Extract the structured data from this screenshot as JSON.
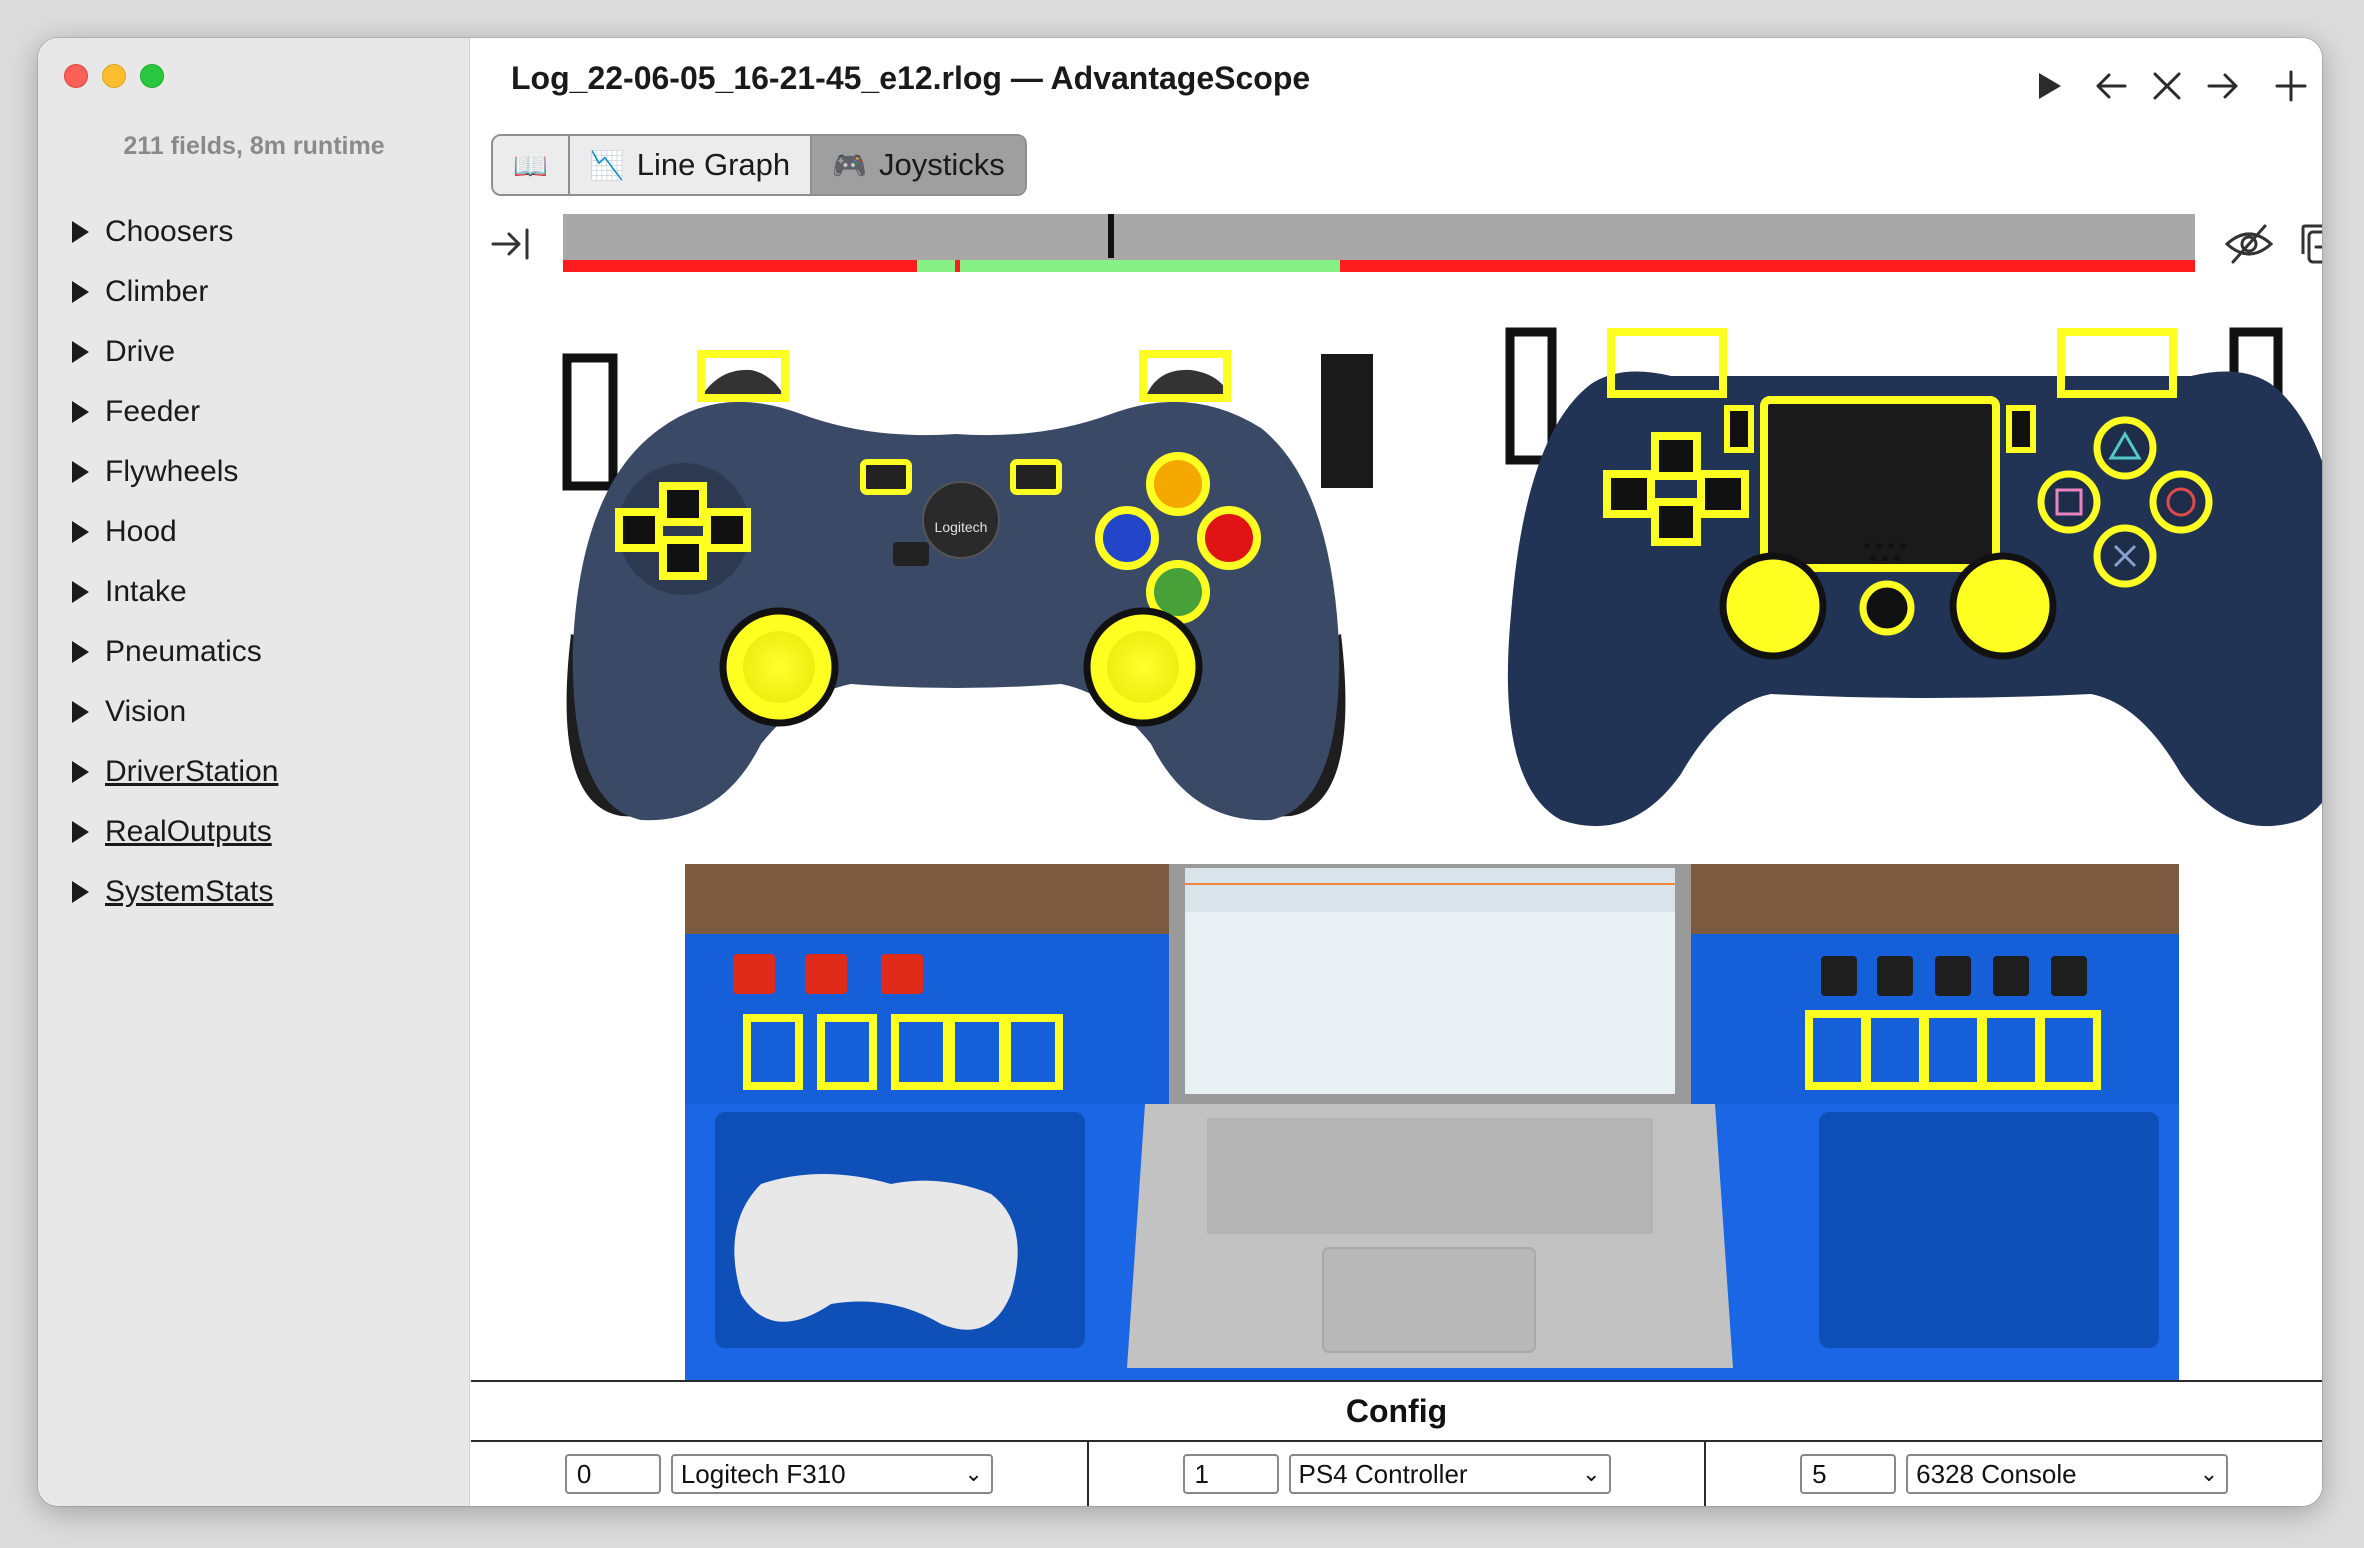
{
  "window": {
    "title": "Log_22-06-05_16-21-45_e12.rlog — AdvantageScope"
  },
  "sidebar": {
    "summary": "211 fields, 8m runtime",
    "items": [
      {
        "label": "Choosers",
        "underline": false
      },
      {
        "label": "Climber",
        "underline": false
      },
      {
        "label": "Drive",
        "underline": false
      },
      {
        "label": "Feeder",
        "underline": false
      },
      {
        "label": "Flywheels",
        "underline": false
      },
      {
        "label": "Hood",
        "underline": false
      },
      {
        "label": "Intake",
        "underline": false
      },
      {
        "label": "Pneumatics",
        "underline": false
      },
      {
        "label": "Vision",
        "underline": false
      },
      {
        "label": "DriverStation",
        "underline": true
      },
      {
        "label": "RealOutputs",
        "underline": true
      },
      {
        "label": "SystemStats",
        "underline": true
      }
    ]
  },
  "tabs": [
    {
      "icon": "📖",
      "label": ""
    },
    {
      "icon": "📉",
      "label": "Line Graph"
    },
    {
      "icon": "🎮",
      "label": "Joysticks"
    }
  ],
  "icons": {
    "play": "play-icon",
    "back": "arrow-left-icon",
    "close": "close-icon",
    "forward": "arrow-right-icon",
    "add": "plus-icon",
    "timeline_start": "jump-to-start-icon",
    "hide": "eye-slash-icon",
    "popout": "new-window-icon"
  },
  "timeline": {
    "cursor_fraction": 0.334,
    "enabled_segments": [
      [
        0.217,
        0.24
      ],
      [
        0.243,
        0.476
      ]
    ]
  },
  "colors": {
    "disabled": "#ff1c1c",
    "enabled": "#86f086",
    "highlight": "#ffff22",
    "gamepad_body": "#3a4a66",
    "ps4_body": "#223455",
    "console_blue": "#1560d8"
  },
  "logos": {
    "logitech": "Logitech"
  },
  "config": {
    "title": "Config",
    "joysticks": [
      {
        "id": "0",
        "type": "Logitech F310"
      },
      {
        "id": "1",
        "type": "PS4 Controller"
      },
      {
        "id": "5",
        "type": "6328 Console"
      }
    ]
  }
}
